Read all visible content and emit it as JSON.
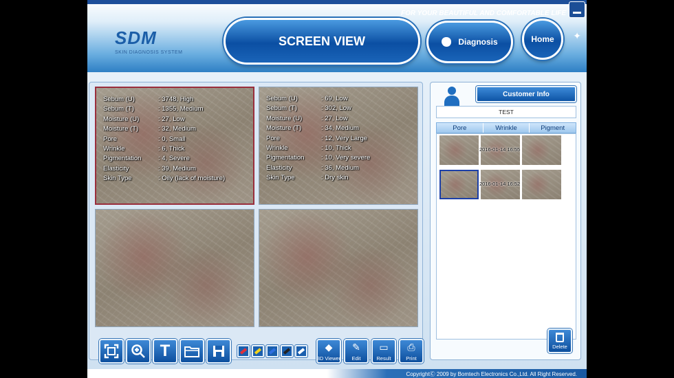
{
  "header": {
    "logo_main": "SDM",
    "logo_sub": "SKIN DIAGNOSIS SYSTEM",
    "slogan": "FOR YOUR BEAUTIFUL AND COMFORTABLE LIFE",
    "screen_view_label": "SCREEN VIEW",
    "diagnosis_label": "Diagnosis",
    "home_label": "Home",
    "minimize_icon": "minimize-icon"
  },
  "images": [
    {
      "rows": [
        {
          "label": "Sebum (U)",
          "value": ": 3748, High"
        },
        {
          "label": "Sebum (T)",
          "value": ": 1355, Medium"
        },
        {
          "label": "Moisture (U)",
          "value": ": 27, Low"
        },
        {
          "label": "Moisture (T)",
          "value": ": 32, Medium"
        },
        {
          "label": "Pore",
          "value": ": 0, Small"
        },
        {
          "label": "Wrinkle",
          "value": ": 6, Thick"
        },
        {
          "label": "Pigmentation",
          "value": ": 4, Severe"
        },
        {
          "label": "Elasticity",
          "value": ": 39, Medium"
        },
        {
          "label": "Skin Type",
          "value": ": Oily (lack of moisture)"
        }
      ]
    },
    {
      "rows": [
        {
          "label": "Sebum (U)",
          "value": ": 69, Low"
        },
        {
          "label": "Sebum (T)",
          "value": ": 302, Low"
        },
        {
          "label": "Moisture (U)",
          "value": ": 27, Low"
        },
        {
          "label": "Moisture (T)",
          "value": ": 34, Medium"
        },
        {
          "label": "Pore",
          "value": ": 12, Very Large"
        },
        {
          "label": "Wrinkle",
          "value": ": 10, Thick"
        },
        {
          "label": "Pigmentation",
          "value": ": 10, Very severe"
        },
        {
          "label": "Elasticity",
          "value": ": 36, Medium"
        },
        {
          "label": "Skin Type",
          "value": ": Dry skin"
        }
      ]
    }
  ],
  "toolbar": {
    "left_icons": [
      "fullscreen-icon",
      "zoom-in-icon",
      "text-icon",
      "folder-icon",
      "save-icon"
    ],
    "text_glyph": "T",
    "pen_colors": [
      "#e0303a",
      "#f2d21a",
      "#2f6fe0",
      "#222222",
      "#ffffff"
    ],
    "right_buttons": [
      {
        "label": "3D Viewer"
      },
      {
        "label": "Edit"
      },
      {
        "label": "Result"
      },
      {
        "label": "Print"
      }
    ]
  },
  "customer": {
    "info_label": "Customer Info",
    "name": "TEST",
    "tabs": [
      "Pore",
      "Wrinkle",
      "Pigment"
    ],
    "thumb_rows": [
      {
        "timestamp": "2016-01-14 16:55"
      },
      {
        "timestamp": "2016-01-14 16:52"
      }
    ],
    "delete_label": "Delete"
  },
  "footer": {
    "copyright": "CopyrightⒸ 2009 by Bomtech Electronics Co.,Ltd.  All Right Reserved."
  },
  "colors": {
    "accent": "#0d4f9e",
    "selected_border": "#9a2d3b"
  }
}
